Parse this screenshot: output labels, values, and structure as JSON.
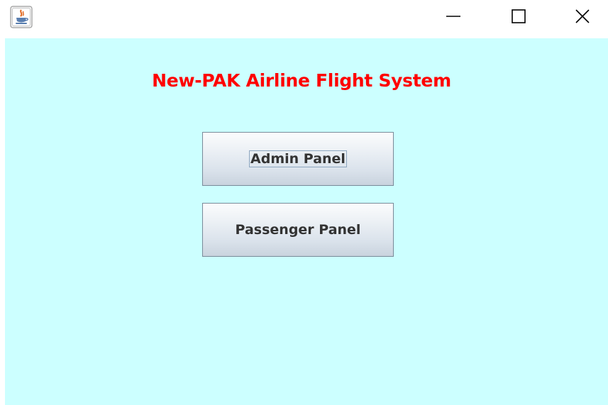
{
  "window": {
    "icon": "java-cup-icon",
    "controls": [
      "minimize-icon",
      "maximize-icon",
      "close-icon"
    ]
  },
  "main": {
    "heading": "New-PAK Airline Flight System",
    "heading_color": "#ff0000",
    "background_color": "#ccffff",
    "buttons": [
      {
        "label": "Admin Panel",
        "focused": true
      },
      {
        "label": "Passenger Panel",
        "focused": false
      }
    ]
  }
}
